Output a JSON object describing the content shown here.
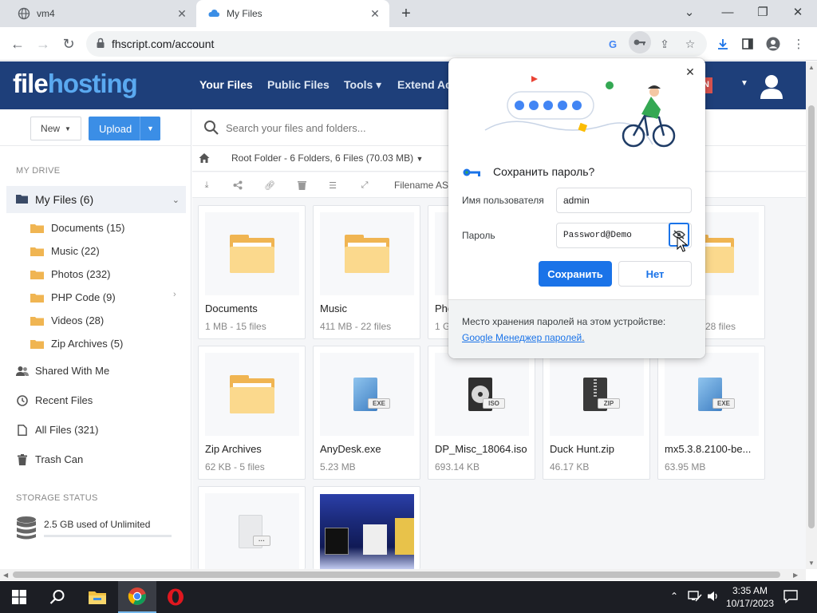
{
  "browser": {
    "tabs": [
      {
        "title": "vm4",
        "active": false
      },
      {
        "title": "My Files",
        "active": true
      }
    ],
    "url": "fhscript.com/account"
  },
  "site": {
    "logo_part1": "file",
    "logo_part2": "hosting",
    "nav": [
      "Your Files",
      "Public Files",
      "Tools",
      "Extend Ac"
    ],
    "admin_badge": "IN"
  },
  "sidebar": {
    "new_label": "New",
    "upload_label": "Upload",
    "my_drive_label": "MY DRIVE",
    "my_files_label": "My Files (6)",
    "folders": [
      "Documents (15)",
      "Music (22)",
      "Photos (232)",
      "PHP Code (9)",
      "Videos (28)",
      "Zip Archives (5)"
    ],
    "items": [
      "Shared With Me",
      "Recent Files",
      "All Files (321)",
      "Trash Can"
    ],
    "storage_label": "STORAGE STATUS",
    "storage_text": "2.5 GB used of Unlimited"
  },
  "main": {
    "search_placeholder": "Search your files and folders...",
    "breadcrumb": "Root Folder - 6 Folders, 6 Files (70.03 MB)",
    "sort_label": "Filename ASC",
    "cards": [
      {
        "name": "Documents",
        "meta": "1 MB - 15 files",
        "kind": "folder"
      },
      {
        "name": "Music",
        "meta": "411 MB - 22 files",
        "kind": "folder"
      },
      {
        "name": "Pho",
        "meta": "1 G",
        "kind": "folder"
      },
      {
        "name": "",
        "meta": "28 files",
        "kind": "folder"
      },
      {
        "name": "Zip Archives",
        "meta": "62 KB - 5 files",
        "kind": "folder"
      },
      {
        "name": "AnyDesk.exe",
        "meta": "5.23 MB",
        "kind": "exe",
        "badge": "EXE"
      },
      {
        "name": "DP_Misc_18064.iso",
        "meta": "693.14 KB",
        "kind": "iso",
        "badge": "ISO"
      },
      {
        "name": "Duck Hunt.zip",
        "meta": "46.17 KB",
        "kind": "zip",
        "badge": "ZIP"
      },
      {
        "name": "mx5.3.8.2100-be...",
        "meta": "63.95 MB",
        "kind": "exe",
        "badge": "EXE"
      }
    ]
  },
  "password_popup": {
    "title": "Сохранить пароль?",
    "username_label": "Имя пользователя",
    "username_value": "admin",
    "password_label": "Пароль",
    "password_value": "Password@Demo",
    "save_label": "Сохранить",
    "no_label": "Нет",
    "footer_text": "Место хранения паролей на этом устройстве:",
    "footer_link": "Google Менеджер паролей",
    "footer_period": "."
  },
  "taskbar": {
    "time": "3:35 AM",
    "date": "10/17/2023"
  },
  "colors": {
    "header": "#1e3f7a",
    "accent": "#3b8ee6",
    "chrome_blue": "#1a73e8",
    "folder": "#f0b552"
  }
}
